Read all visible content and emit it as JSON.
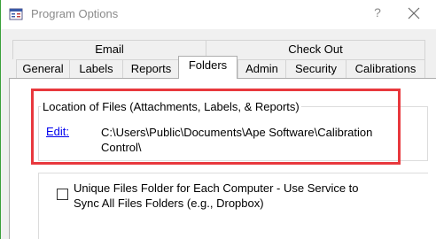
{
  "window": {
    "title": "Program Options",
    "help_glyph": "?",
    "close_icon": "close-icon"
  },
  "tabs": {
    "row1": [
      {
        "label": "Email"
      },
      {
        "label": "Check Out"
      }
    ],
    "row2": [
      {
        "label": "General"
      },
      {
        "label": "Labels"
      },
      {
        "label": "Reports"
      },
      {
        "label": "Folders",
        "active": true
      },
      {
        "label": "Admin"
      },
      {
        "label": "Security"
      },
      {
        "label": "Calibrations"
      }
    ]
  },
  "files_group": {
    "title": "Location of Files (Attachments, Labels, & Reports)",
    "edit_label": "Edit:",
    "path_line1": "C:\\Users\\Public\\Documents\\Ape Software\\Calibration",
    "path_line2": "Control\\"
  },
  "unique_folder_option": {
    "checked": false,
    "label_line1": "Unique Files Folder for Each Computer - Use Service to",
    "label_line2": "Sync All Files Folders (e.g., Dropbox)"
  },
  "colors": {
    "highlight": "#e8383d",
    "link": "#0000ee",
    "dialog_bg": "#f0f0f0",
    "panel_bg": "#ffffff"
  }
}
